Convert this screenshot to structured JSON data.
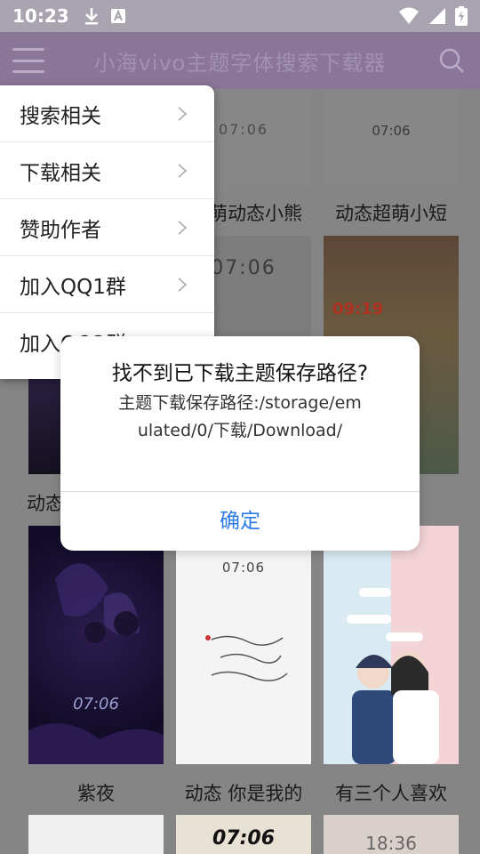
{
  "status_bar": {
    "time": "10:23",
    "left_icons": [
      "download-icon",
      "keyboard-a-icon"
    ],
    "right_icons": [
      "wifi-icon",
      "signal-icon",
      "battery-charging-icon"
    ]
  },
  "app_bar": {
    "title": "小海vivo主题字体搜索下载器",
    "menu_icon": "hamburger-icon",
    "search_icon": "search-icon"
  },
  "grid": {
    "items": [
      {
        "caption": "萌动态小熊",
        "clock": "07:06"
      },
      {
        "caption": "动态超萌小短",
        "clock": "07:06"
      },
      {
        "caption": "动态",
        "clock": ""
      },
      {
        "caption": "",
        "clock": "07:06"
      },
      {
        "caption": "",
        "clock": "09:19"
      },
      {
        "caption": "紫夜",
        "clock": "07:06"
      },
      {
        "caption": "动态 你是我的",
        "clock": "07:06"
      },
      {
        "caption": "有三个人喜欢",
        "clock": ""
      },
      {
        "caption": "",
        "clock": ""
      },
      {
        "caption": "",
        "clock": "07:06"
      },
      {
        "caption": "",
        "clock": "18:36"
      }
    ]
  },
  "popup_menu": {
    "items": [
      {
        "label": "搜索相关"
      },
      {
        "label": "下载相关"
      },
      {
        "label": "赞助作者"
      },
      {
        "label": "加入QQ1群"
      },
      {
        "label": "加入QQ2群"
      }
    ]
  },
  "dialog": {
    "title": "找不到已下载主题保存路径?",
    "message": "主题下载保存路径:/storage/emulated/0/下载/Download/",
    "confirm_label": "确定"
  },
  "colors": {
    "status_bar": "#a9a4af",
    "app_bar": "#8a7698",
    "dialog_button": "#2c7be5"
  }
}
